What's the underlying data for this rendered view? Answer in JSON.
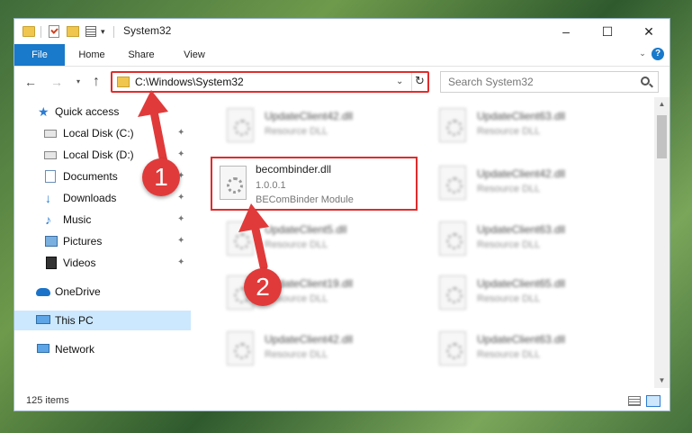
{
  "window": {
    "title": "System32",
    "controls": {
      "minimize": "–",
      "maximize": "☐",
      "close": "✕"
    }
  },
  "quick_access_toolbar": {
    "dropdown": "▾"
  },
  "ribbon": {
    "tabs": [
      {
        "label": "File",
        "active": true
      },
      {
        "label": "Home"
      },
      {
        "label": "Share"
      },
      {
        "label": "View"
      }
    ],
    "expand": "⌄",
    "help": "?"
  },
  "nav": {
    "back": "←",
    "forward": "→",
    "recent": "▾",
    "up": "↑",
    "address": "C:\\Windows\\System32",
    "address_dropdown": "⌄",
    "refresh": "↻",
    "search_placeholder": "Search System32"
  },
  "sidebar": {
    "items": [
      {
        "label": "Quick access",
        "icon": "star-icon"
      },
      {
        "label": "Local Disk (C:)",
        "icon": "disk-icon",
        "pinned": true
      },
      {
        "label": "Local Disk (D:)",
        "icon": "disk-icon",
        "pinned": true
      },
      {
        "label": "Documents",
        "icon": "documents-icon",
        "pinned": true
      },
      {
        "label": "Downloads",
        "icon": "downloads-icon",
        "pinned": true
      },
      {
        "label": "Music",
        "icon": "music-icon",
        "pinned": true
      },
      {
        "label": "Pictures",
        "icon": "pictures-icon",
        "pinned": true
      },
      {
        "label": "Videos",
        "icon": "videos-icon",
        "pinned": true
      },
      {
        "label": "OneDrive",
        "icon": "onedrive-icon"
      },
      {
        "label": "This PC",
        "icon": "this-pc-icon",
        "selected": true
      },
      {
        "label": "Network",
        "icon": "network-icon"
      }
    ],
    "pin_glyph": "📌"
  },
  "files": [
    {
      "name": "UpdateClient42.dll",
      "line2": "Resource DLL",
      "blurred": true
    },
    {
      "name": "UpdateClient63.dll",
      "line2": "Resource DLL",
      "blurred": true
    },
    {
      "name": "becombinder.dll",
      "line2": "1.0.0.1",
      "line3": "BEComBinder Module",
      "highlighted": true
    },
    {
      "name": "UpdateClient42.dll",
      "line2": "Resource DLL",
      "blurred": true
    },
    {
      "name": "UpdateClient5.dll",
      "line2": "Resource DLL",
      "blurred": true
    },
    {
      "name": "UpdateClient63.dll",
      "line2": "Resource DLL",
      "blurred": true
    },
    {
      "name": "UpdateClient19.dll",
      "line2": "Resource DLL",
      "blurred": true
    },
    {
      "name": "UpdateClient65.dll",
      "line2": "Resource DLL",
      "blurred": true
    },
    {
      "name": "UpdateClient42.dll",
      "line2": "Resource DLL",
      "blurred": true
    },
    {
      "name": "UpdateClient63.dll",
      "line2": "Resource DLL",
      "blurred": true
    }
  ],
  "scrollbar": {
    "up": "▲",
    "down": "▼"
  },
  "status": {
    "item_count": "125 items"
  },
  "annotations": {
    "marker1": "1",
    "marker2": "2",
    "color": "#e03a3a"
  }
}
